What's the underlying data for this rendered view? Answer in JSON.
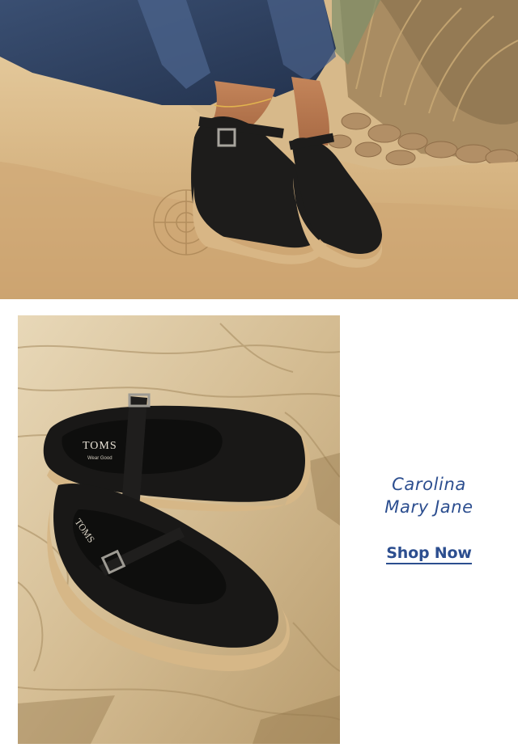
{
  "product": {
    "name_line1": "Carolina",
    "name_line2": "Mary Jane",
    "cta_label": "Shop Now"
  },
  "brand": {
    "logo_text": "TOMS",
    "tagline": "Wear Good"
  },
  "colors": {
    "accent": "#2c4e8f",
    "background": "#ffffff",
    "shoe": "#1c1b1a",
    "jute": "#d9b98c"
  }
}
